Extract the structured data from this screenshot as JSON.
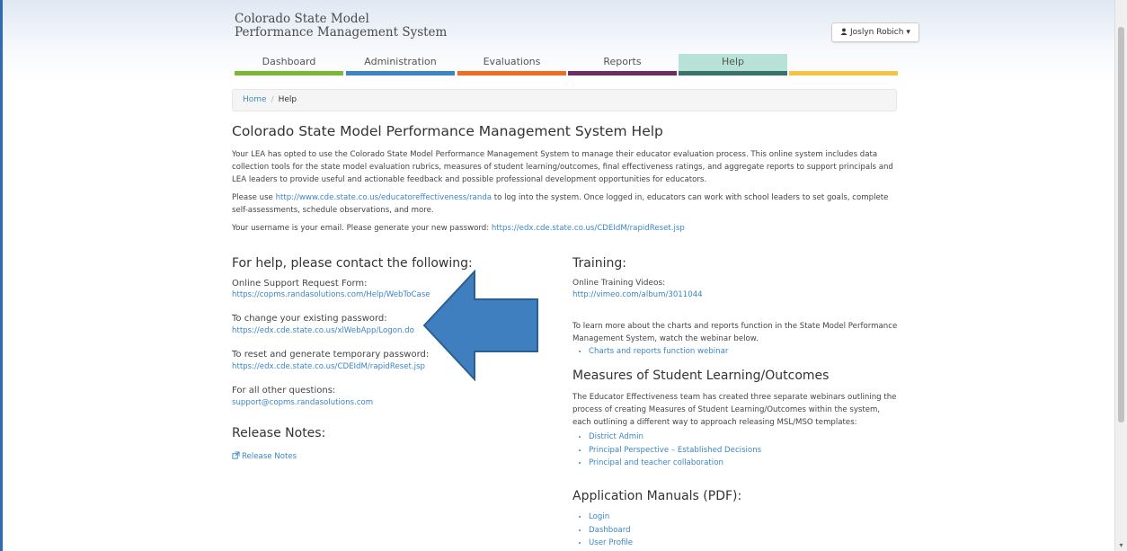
{
  "brand": {
    "line1": "Colorado State Model",
    "line2": "Performance Management System"
  },
  "user_menu": {
    "icon": "user-icon",
    "name": "Joslyn Robich",
    "caret": "▾"
  },
  "nav": {
    "tabs": [
      {
        "label": "Dashboard",
        "color": "#7bb834"
      },
      {
        "label": "Administration",
        "color": "#3d84c5"
      },
      {
        "label": "Evaluations",
        "color": "#ee6c23"
      },
      {
        "label": "Reports",
        "color": "#6d2f63"
      },
      {
        "label": "Help",
        "color": "#39736b",
        "active": true
      },
      {
        "label": "",
        "color": "#f4c341"
      }
    ]
  },
  "breadcrumb": {
    "home": "Home",
    "separator": "/",
    "current": "Help"
  },
  "page": {
    "title": "Colorado State Model Performance Management System Help",
    "intro": "Your LEA has opted to use the Colorado State Model Performance Management System to manage their educator evaluation process. This online system includes data collection tools for the state model evaluation rubrics, measures of student learning/outcomes, final effectiveness ratings, and aggregate reports to support principals and LEA leaders to provide useful and actionable feedback and possible professional development opportunities for educators.",
    "login_pre": "Please use ",
    "login_link": "http://www.cde.state.co.us/educatoreffectiveness/randa",
    "login_post": " to log into the system. Once logged in, educators can work with school leaders to set goals, complete self-assessments, schedule observations, and more.",
    "username_pre": "Your username is your email. Please generate your new password: ",
    "username_link": "https://edx.cde.state.co.us/CDEIdM/rapidReset.jsp"
  },
  "contact": {
    "heading": "For help, please contact the following:",
    "items": [
      {
        "label": "Online Support Request Form:",
        "link": "https://copms.randasolutions.com/Help/WebToCase"
      },
      {
        "label": "To change your existing password:",
        "link": "https://edx.cde.state.co.us/xlWebApp/Logon.do"
      },
      {
        "label": "To reset and generate temporary password:",
        "link": "https://edx.cde.state.co.us/CDEIdM/rapidReset.jsp"
      },
      {
        "label": "For all other questions:",
        "link": "support@copms.randasolutions.com"
      }
    ]
  },
  "release": {
    "heading": "Release Notes:",
    "link": "Release Notes",
    "icon": "external-link-icon"
  },
  "training": {
    "heading": "Training:",
    "videos_label": "Online Training Videos:",
    "videos_link": "http://vimeo.com/album/3011044",
    "charts_text": "To learn more about the charts and reports function in the State Model Performance Management System, watch the webinar below.",
    "charts_items": [
      "Charts and reports function webinar"
    ]
  },
  "msl": {
    "heading": "Measures of Student Learning/Outcomes",
    "text": "The Educator Effectiveness team has created three separate webinars outlining the process of creating Measures of Student Learning/Outcomes within the system, each outlining a different way to approach releasing MSL/MSO templates:",
    "items": [
      "District Admin",
      "Principal Perspective – Established Decisions",
      "Principal and teacher collaboration"
    ]
  },
  "manuals": {
    "heading": "Application Manuals (PDF):",
    "items": [
      "Login",
      "Dashboard",
      "User Profile"
    ]
  },
  "annotation": {
    "arrow_color": "#3f7fc0",
    "arrow_border": "#2c5f91"
  }
}
